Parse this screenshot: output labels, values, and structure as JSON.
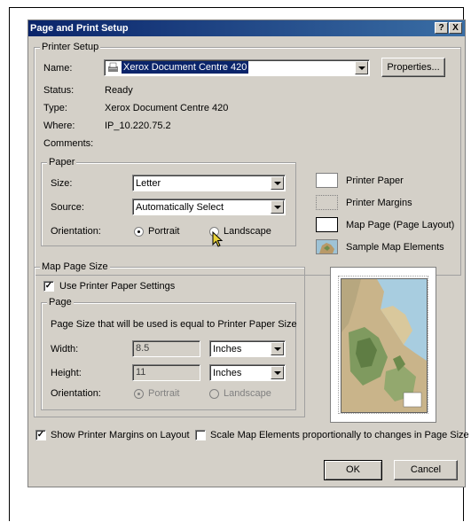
{
  "dialog": {
    "title": "Page and Print Setup",
    "help_button": "?",
    "close_button": "X"
  },
  "printer_setup": {
    "group_title": "Printer Setup",
    "name_label": "Name:",
    "name_value": "Xerox Document Centre 420",
    "properties_button": "Properties...",
    "status_label": "Status:",
    "status_value": "Ready",
    "type_label": "Type:",
    "type_value": "Xerox Document Centre 420",
    "where_label": "Where:",
    "where_value": "IP_10.220.75.2",
    "comments_label": "Comments:"
  },
  "paper": {
    "group_title": "Paper",
    "size_label": "Size:",
    "size_value": "Letter",
    "source_label": "Source:",
    "source_value": "Automatically Select",
    "orientation_label": "Orientation:",
    "portrait_label": "Portrait",
    "landscape_label": "Landscape"
  },
  "legend": {
    "printer_paper": "Printer Paper",
    "printer_margins": "Printer Margins",
    "map_page": "Map Page (Page Layout)",
    "sample_map": "Sample Map Elements"
  },
  "map_page_size": {
    "group_title": "Map Page Size",
    "use_printer_paper": "Use Printer Paper Settings",
    "page_group_title": "Page",
    "info_text": "Page Size that will be used is equal to Printer Paper Size",
    "width_label": "Width:",
    "width_value": "8.5",
    "width_unit": "Inches",
    "height_label": "Height:",
    "height_value": "11",
    "height_unit": "Inches",
    "orientation_label": "Orientation:",
    "portrait_label": "Portrait",
    "landscape_label": "Landscape"
  },
  "bottom": {
    "show_margins": "Show Printer Margins on Layout",
    "scale_elements": "Scale Map Elements proportionally to changes in Page Size",
    "ok_button": "OK",
    "cancel_button": "Cancel"
  }
}
